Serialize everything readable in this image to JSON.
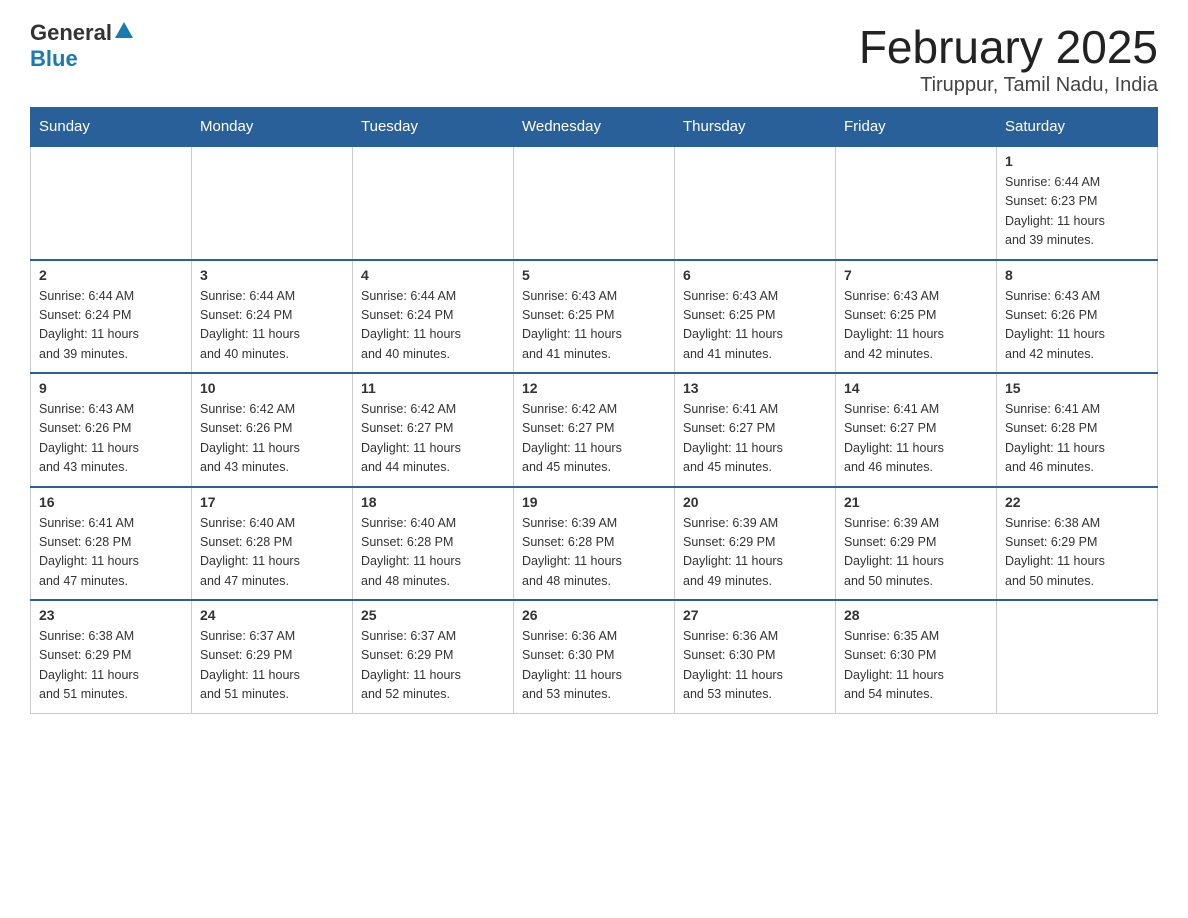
{
  "logo": {
    "text_general": "General",
    "text_blue": "Blue",
    "arrow": "▲"
  },
  "title": "February 2025",
  "subtitle": "Tiruppur, Tamil Nadu, India",
  "days_of_week": [
    "Sunday",
    "Monday",
    "Tuesday",
    "Wednesday",
    "Thursday",
    "Friday",
    "Saturday"
  ],
  "weeks": [
    [
      {
        "day": "",
        "info": ""
      },
      {
        "day": "",
        "info": ""
      },
      {
        "day": "",
        "info": ""
      },
      {
        "day": "",
        "info": ""
      },
      {
        "day": "",
        "info": ""
      },
      {
        "day": "",
        "info": ""
      },
      {
        "day": "1",
        "info": "Sunrise: 6:44 AM\nSunset: 6:23 PM\nDaylight: 11 hours\nand 39 minutes."
      }
    ],
    [
      {
        "day": "2",
        "info": "Sunrise: 6:44 AM\nSunset: 6:24 PM\nDaylight: 11 hours\nand 39 minutes."
      },
      {
        "day": "3",
        "info": "Sunrise: 6:44 AM\nSunset: 6:24 PM\nDaylight: 11 hours\nand 40 minutes."
      },
      {
        "day": "4",
        "info": "Sunrise: 6:44 AM\nSunset: 6:24 PM\nDaylight: 11 hours\nand 40 minutes."
      },
      {
        "day": "5",
        "info": "Sunrise: 6:43 AM\nSunset: 6:25 PM\nDaylight: 11 hours\nand 41 minutes."
      },
      {
        "day": "6",
        "info": "Sunrise: 6:43 AM\nSunset: 6:25 PM\nDaylight: 11 hours\nand 41 minutes."
      },
      {
        "day": "7",
        "info": "Sunrise: 6:43 AM\nSunset: 6:25 PM\nDaylight: 11 hours\nand 42 minutes."
      },
      {
        "day": "8",
        "info": "Sunrise: 6:43 AM\nSunset: 6:26 PM\nDaylight: 11 hours\nand 42 minutes."
      }
    ],
    [
      {
        "day": "9",
        "info": "Sunrise: 6:43 AM\nSunset: 6:26 PM\nDaylight: 11 hours\nand 43 minutes."
      },
      {
        "day": "10",
        "info": "Sunrise: 6:42 AM\nSunset: 6:26 PM\nDaylight: 11 hours\nand 43 minutes."
      },
      {
        "day": "11",
        "info": "Sunrise: 6:42 AM\nSunset: 6:27 PM\nDaylight: 11 hours\nand 44 minutes."
      },
      {
        "day": "12",
        "info": "Sunrise: 6:42 AM\nSunset: 6:27 PM\nDaylight: 11 hours\nand 45 minutes."
      },
      {
        "day": "13",
        "info": "Sunrise: 6:41 AM\nSunset: 6:27 PM\nDaylight: 11 hours\nand 45 minutes."
      },
      {
        "day": "14",
        "info": "Sunrise: 6:41 AM\nSunset: 6:27 PM\nDaylight: 11 hours\nand 46 minutes."
      },
      {
        "day": "15",
        "info": "Sunrise: 6:41 AM\nSunset: 6:28 PM\nDaylight: 11 hours\nand 46 minutes."
      }
    ],
    [
      {
        "day": "16",
        "info": "Sunrise: 6:41 AM\nSunset: 6:28 PM\nDaylight: 11 hours\nand 47 minutes."
      },
      {
        "day": "17",
        "info": "Sunrise: 6:40 AM\nSunset: 6:28 PM\nDaylight: 11 hours\nand 47 minutes."
      },
      {
        "day": "18",
        "info": "Sunrise: 6:40 AM\nSunset: 6:28 PM\nDaylight: 11 hours\nand 48 minutes."
      },
      {
        "day": "19",
        "info": "Sunrise: 6:39 AM\nSunset: 6:28 PM\nDaylight: 11 hours\nand 48 minutes."
      },
      {
        "day": "20",
        "info": "Sunrise: 6:39 AM\nSunset: 6:29 PM\nDaylight: 11 hours\nand 49 minutes."
      },
      {
        "day": "21",
        "info": "Sunrise: 6:39 AM\nSunset: 6:29 PM\nDaylight: 11 hours\nand 50 minutes."
      },
      {
        "day": "22",
        "info": "Sunrise: 6:38 AM\nSunset: 6:29 PM\nDaylight: 11 hours\nand 50 minutes."
      }
    ],
    [
      {
        "day": "23",
        "info": "Sunrise: 6:38 AM\nSunset: 6:29 PM\nDaylight: 11 hours\nand 51 minutes."
      },
      {
        "day": "24",
        "info": "Sunrise: 6:37 AM\nSunset: 6:29 PM\nDaylight: 11 hours\nand 51 minutes."
      },
      {
        "day": "25",
        "info": "Sunrise: 6:37 AM\nSunset: 6:29 PM\nDaylight: 11 hours\nand 52 minutes."
      },
      {
        "day": "26",
        "info": "Sunrise: 6:36 AM\nSunset: 6:30 PM\nDaylight: 11 hours\nand 53 minutes."
      },
      {
        "day": "27",
        "info": "Sunrise: 6:36 AM\nSunset: 6:30 PM\nDaylight: 11 hours\nand 53 minutes."
      },
      {
        "day": "28",
        "info": "Sunrise: 6:35 AM\nSunset: 6:30 PM\nDaylight: 11 hours\nand 54 minutes."
      },
      {
        "day": "",
        "info": ""
      }
    ]
  ]
}
